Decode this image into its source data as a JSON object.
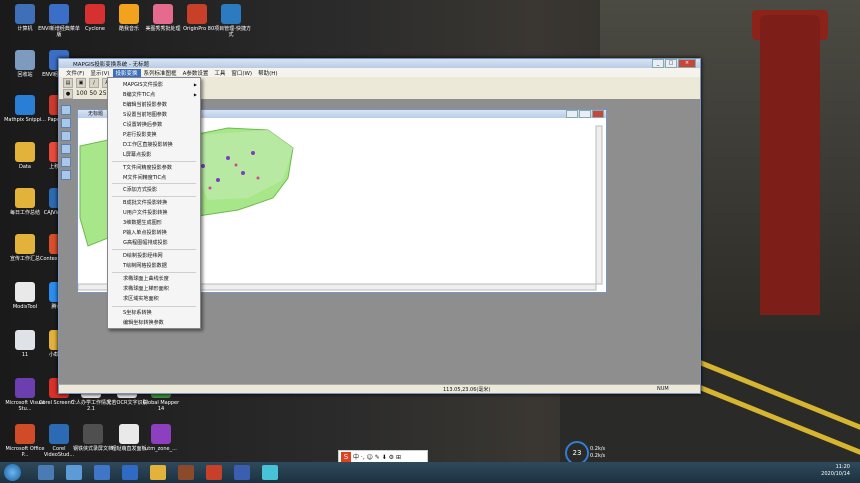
{
  "desktop_icons": [
    {
      "label": "计算机",
      "color": "#3f6fb6"
    },
    {
      "label": "ENVI新增经典菜单版",
      "color": "#3b6fc7"
    },
    {
      "label": "Cyclone",
      "color": "#d63030"
    },
    {
      "label": "酷我音乐",
      "color": "#f2a21d"
    },
    {
      "label": "美图秀秀批处理",
      "color": "#e46a8e"
    },
    {
      "label": "OriginPro 8",
      "color": "#c8402a"
    },
    {
      "label": "0项目管理-快捷方式",
      "color": "#2c7ac0"
    },
    {
      "label": "回收站",
      "color": "#7c9bbf"
    },
    {
      "label": "ENVI经典Mo...",
      "color": "#3b6fc7"
    },
    {
      "label": "Mathpix Snippi...",
      "color": "#2b7ed6"
    },
    {
      "label": "PaperO...",
      "color": "#cc3a2d"
    },
    {
      "label": "Data",
      "color": "#e2b23a"
    },
    {
      "label": "上移桌...",
      "color": "#e84b3c"
    },
    {
      "label": "每日工作总结",
      "color": "#e2b23a"
    },
    {
      "label": "CAJVie... 7.2",
      "color": "#2c6ab3"
    },
    {
      "label": "宣传工作汇总",
      "color": "#e2b23a"
    },
    {
      "label": "Context Center",
      "color": "#d84f2a"
    },
    {
      "label": "ModisTool",
      "color": "#e9e9e9"
    },
    {
      "label": "腾讯云",
      "color": "#2b8df0"
    },
    {
      "label": "11",
      "color": "#dfe3e8"
    },
    {
      "label": "小截图标",
      "color": "#e2b23a"
    },
    {
      "label": "Microsoft Visual Stu...",
      "color": "#6c3fb0"
    },
    {
      "label": "Corel ScreenC...",
      "color": "#d9302a"
    },
    {
      "label": "个人办学工作情况2.1",
      "color": "#e9e9e9"
    },
    {
      "label": "天若OCR文字识别",
      "color": "#e9e9e9"
    },
    {
      "label": "Global Mapper 14",
      "color": "#3d8f3d"
    },
    {
      "label": "Microsoft Office P...",
      "color": "#d04b27"
    },
    {
      "label": "Corel VideoStud...",
      "color": "#2c6ab3"
    },
    {
      "label": "钢铁侠式录屏文档",
      "color": "#4f4f4f"
    },
    {
      "label": "哩哒萌直发面板",
      "color": "#e9e9e9"
    },
    {
      "label": "utm_zone_...",
      "color": "#8c3fbf"
    }
  ],
  "window": {
    "title": "MAPGIS投影变换系统 - 无标题",
    "menus": [
      "文件(F)",
      "显示(V)",
      "投影变换",
      "系列标准图框",
      "A参数设置",
      "工具",
      "窗口(W)",
      "帮助(H)"
    ],
    "active_menu_index": 2,
    "toolbar_text": "100  50  25",
    "toolbar_text2": "5e"
  },
  "child_window": {
    "title": "无标题"
  },
  "dropdown": {
    "items": [
      {
        "label": "MAPGIS文件投影",
        "submenu": true
      },
      {
        "label": "B编文件TIC点",
        "submenu": true
      },
      {
        "label": "E编辑当前投影参数",
        "submenu": false
      },
      {
        "label": "S设置当前地图参数",
        "submenu": false
      },
      {
        "label": "C设置转换后参数",
        "submenu": false
      },
      {
        "label": "P进行投影变换",
        "submenu": false
      },
      {
        "label": "D工作区直接投影转换",
        "submenu": false
      },
      {
        "label": "L屏幕点投影",
        "submenu": false
      },
      {
        "label": "T文件间精度投影参数",
        "submenu": false
      },
      {
        "label": "M文件间精度TIC点",
        "submenu": false
      },
      {
        "label": "C添加方式投影",
        "submenu": false
      },
      {
        "label": "B成批文件投影转换",
        "submenu": false
      },
      {
        "label": "U用户文件投影转换",
        "submenu": false
      },
      {
        "label": "3维数据生成图形",
        "submenu": false
      },
      {
        "label": "P输入单点投影转换",
        "submenu": false
      },
      {
        "label": "G高程图幅排成投影",
        "submenu": false
      },
      {
        "label": "D绘制投影经纬网",
        "submenu": false
      },
      {
        "label": "T绘制网格投影数据",
        "submenu": false
      },
      {
        "label": "求椭球面上曲线长度",
        "submenu": false
      },
      {
        "label": "求椭球面上梯形面积",
        "submenu": false
      },
      {
        "label": "求区域实地面积",
        "submenu": false
      },
      {
        "label": "S坐标系转换",
        "submenu": false
      },
      {
        "label": "编辑坐标转换参数",
        "submenu": false
      }
    ]
  },
  "statusbar": {
    "coords": "113.05,23.06(毫米)",
    "num": "NUM"
  },
  "ime": {
    "text": "中 ·, ☺ ✎ ⬇ ⚙ ⊞"
  },
  "net_widget": {
    "percent": "23",
    "up": "0.2k/s",
    "down": "0.2k/s"
  },
  "tray": {
    "time": "11:20",
    "date": "2020/10/14"
  }
}
